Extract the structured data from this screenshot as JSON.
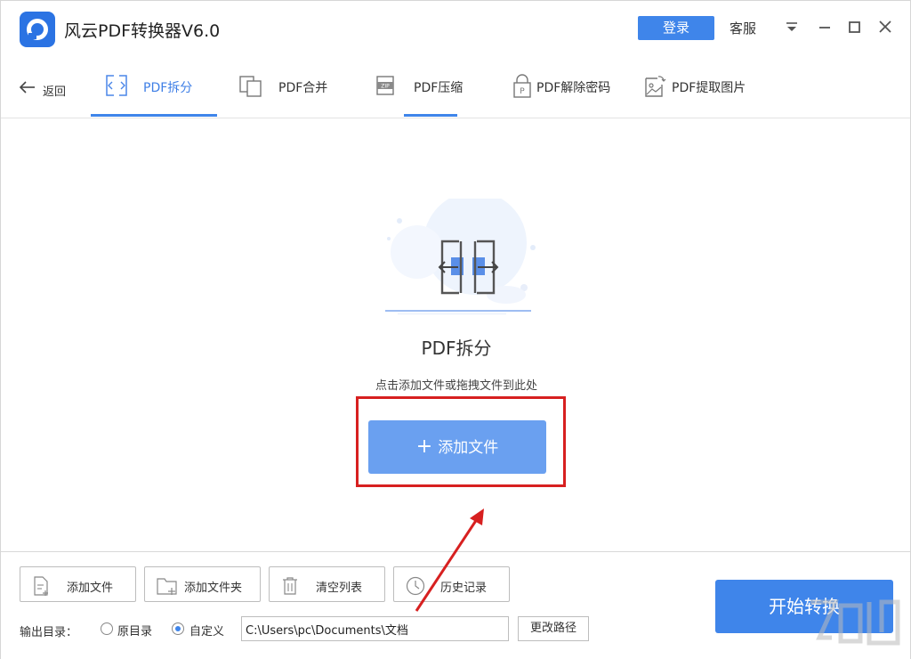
{
  "app": {
    "title": "风云PDF转换器V6.0",
    "login_label": "登录",
    "service_label": "客服"
  },
  "nav": {
    "back_label": "返回",
    "tabs": [
      {
        "label": "PDF拆分",
        "icon": "split-icon",
        "active": true
      },
      {
        "label": "PDF合并",
        "icon": "merge-icon",
        "active": false
      },
      {
        "label": "PDF压缩",
        "icon": "zip-icon",
        "active": false
      },
      {
        "label": "PDF解除密码",
        "icon": "unlock-pdf-icon",
        "active": false
      },
      {
        "label": "PDF提取图片",
        "icon": "extract-image-icon",
        "active": false
      }
    ]
  },
  "main": {
    "title": "PDF拆分",
    "hint": "点击添加文件或拖拽文件到此处",
    "add_file_label": "添加文件"
  },
  "toolbar": {
    "add_file": "添加文件",
    "add_folder": "添加文件夹",
    "clear_list": "清空列表",
    "history": "历史记录"
  },
  "output": {
    "label": "输出目录：",
    "option_original": "原目录",
    "option_custom": "自定义",
    "selected": "自定义",
    "path": "C:\\Users\\pc\\Documents\\文档",
    "change_path_label": "更改路径"
  },
  "start_label": "开始转换",
  "colors": {
    "accent": "#3f85ea",
    "add_button": "#6aa0f0",
    "highlight": "#d72020"
  }
}
